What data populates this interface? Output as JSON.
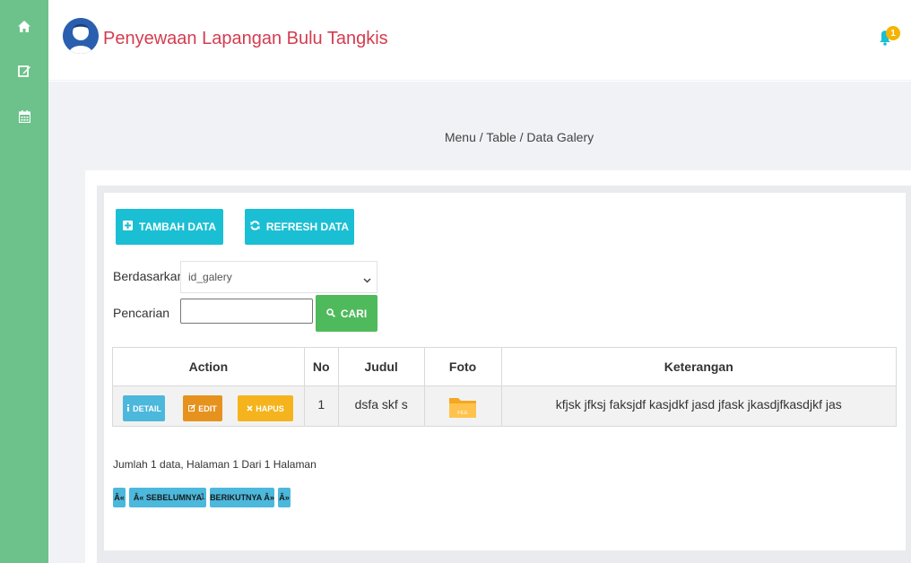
{
  "header": {
    "title": "Penyewaan Lapangan Bulu Tangkis",
    "notification_count": "1"
  },
  "sidebar": {
    "items": [
      {
        "icon": "home-icon"
      },
      {
        "icon": "edit-icon"
      },
      {
        "icon": "calendar-icon"
      }
    ]
  },
  "breadcrumb": "Menu / Table / Data Galery",
  "toolbar": {
    "add_label": "TAMBAH DATA",
    "refresh_label": "REFRESH DATA"
  },
  "filter": {
    "by_label": "Berdasarkan:",
    "by_value": "id_galery",
    "search_label": "Pencarian",
    "search_separator": ":",
    "search_value": "",
    "search_button": "CARI"
  },
  "table": {
    "columns": [
      "Action",
      "No",
      "Judul",
      "Foto",
      "Keterangan"
    ],
    "rows": [
      {
        "actions": {
          "detail": "DETAIL",
          "edit": "EDIT",
          "delete": "HAPUS"
        },
        "no": "1",
        "judul": "dsfa skf s",
        "foto": "FILE",
        "keterangan": "kfjsk jfksj faksjdf kasjdkf jasd jfask jkasdjfkasdjkf jas"
      }
    ]
  },
  "summary": "Jumlah 1 data, Halaman 1 Dari 1 Halaman",
  "pagination": {
    "first": "Â«",
    "prev": "Â« SEBELUMNYA",
    "current": "1",
    "next": "BERIKUTNYA Â»",
    "last": "Â»"
  },
  "colors": {
    "sidebar": "#6cc28a",
    "title": "#d43c4f",
    "primary_button": "#1bbfd3",
    "search_button": "#4fba5b",
    "detail_button": "#4cb8dc",
    "edit_button": "#e6921f",
    "delete_button": "#f5b41d",
    "badge": "#f5b400"
  }
}
